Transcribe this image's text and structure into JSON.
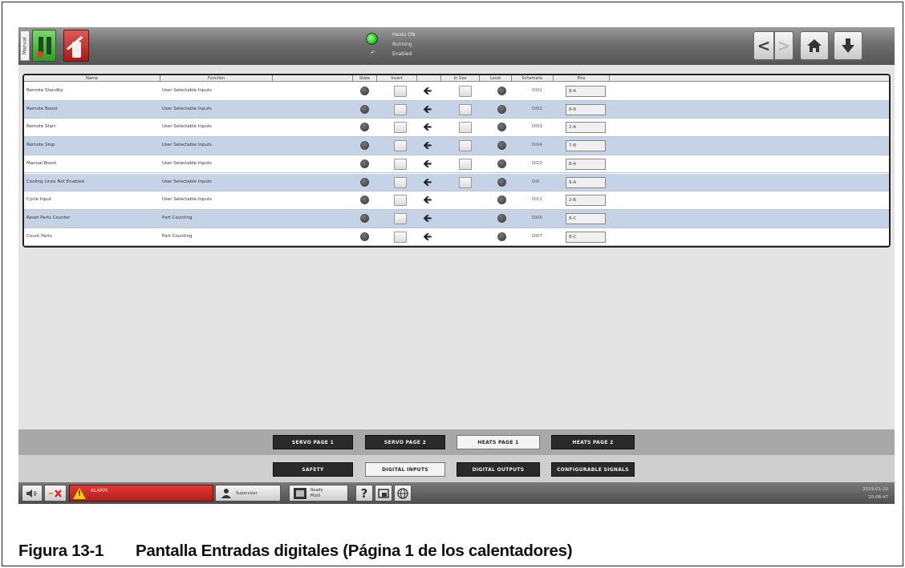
{
  "topbar": {
    "side_tab": "Manual",
    "status_lines": [
      "Heats ON",
      "Running",
      "Enabled"
    ],
    "status_sub": "↶",
    "nav": {
      "back": "<",
      "forward": ">",
      "home": "home-icon",
      "down": "download-icon"
    }
  },
  "table": {
    "headers": [
      "Name",
      "Function",
      "State",
      "Invert",
      "",
      "In Use",
      "Level",
      "Schematic",
      "Pins"
    ],
    "rows": [
      {
        "name": "Remote Standby",
        "function": "User Selectable Inputs",
        "schematic": "DI01",
        "pins": "8-A"
      },
      {
        "name": "Remote Boost",
        "function": "User Selectable Inputs",
        "schematic": "DI02",
        "pins": "8-B"
      },
      {
        "name": "Remote Start",
        "function": "User Selectable Inputs",
        "schematic": "DI03",
        "pins": "2-A"
      },
      {
        "name": "Remote Stop",
        "function": "User Selectable Inputs",
        "schematic": "DI04",
        "pins": "7-B"
      },
      {
        "name": "Manual Boost",
        "function": "User Selectable Inputs",
        "schematic": "DI10",
        "pins": "8-A"
      },
      {
        "name": "Cooling Lines Not Enabled",
        "function": "User Selectable Inputs",
        "schematic": "DI0",
        "pins": "9-A"
      },
      {
        "name": "Cycle Input",
        "function": "User Selectable Inputs",
        "schematic": "DI11",
        "pins": "2-B"
      },
      {
        "name": "Reset Parts Counter",
        "function": "Part Counting",
        "schematic": "DI06",
        "pins": "8-C"
      },
      {
        "name": "Count Parts",
        "function": "Part Counting",
        "schematic": "DI07",
        "pins": "8-C"
      }
    ]
  },
  "tabs_row1": [
    {
      "label": "SERVO PAGE 1",
      "active": false
    },
    {
      "label": "SERVO PAGE 2",
      "active": false
    },
    {
      "label": "HEATS PAGE 1",
      "active": true
    },
    {
      "label": "HEATS PAGE 2",
      "active": false
    }
  ],
  "tabs_row2": [
    {
      "label": "SAFETY",
      "active": false
    },
    {
      "label": "DIGITAL INPUTS",
      "active": true
    },
    {
      "label": "DIGITAL OUTPUTS",
      "active": false
    },
    {
      "label": "CONFIGURABLE SIGNALS",
      "active": false
    }
  ],
  "bottombar": {
    "alarm_text": "ALARM",
    "user_text": "Supervisor",
    "mold_text": "Ready",
    "mold_sub": "Mold",
    "help": "?",
    "clock_date": "2019-01-22",
    "clock_time": "10:08:47"
  },
  "caption": {
    "number": "Figura 13-1",
    "text": "Pantalla Entradas digitales (Página 1 de los calentadores)"
  }
}
